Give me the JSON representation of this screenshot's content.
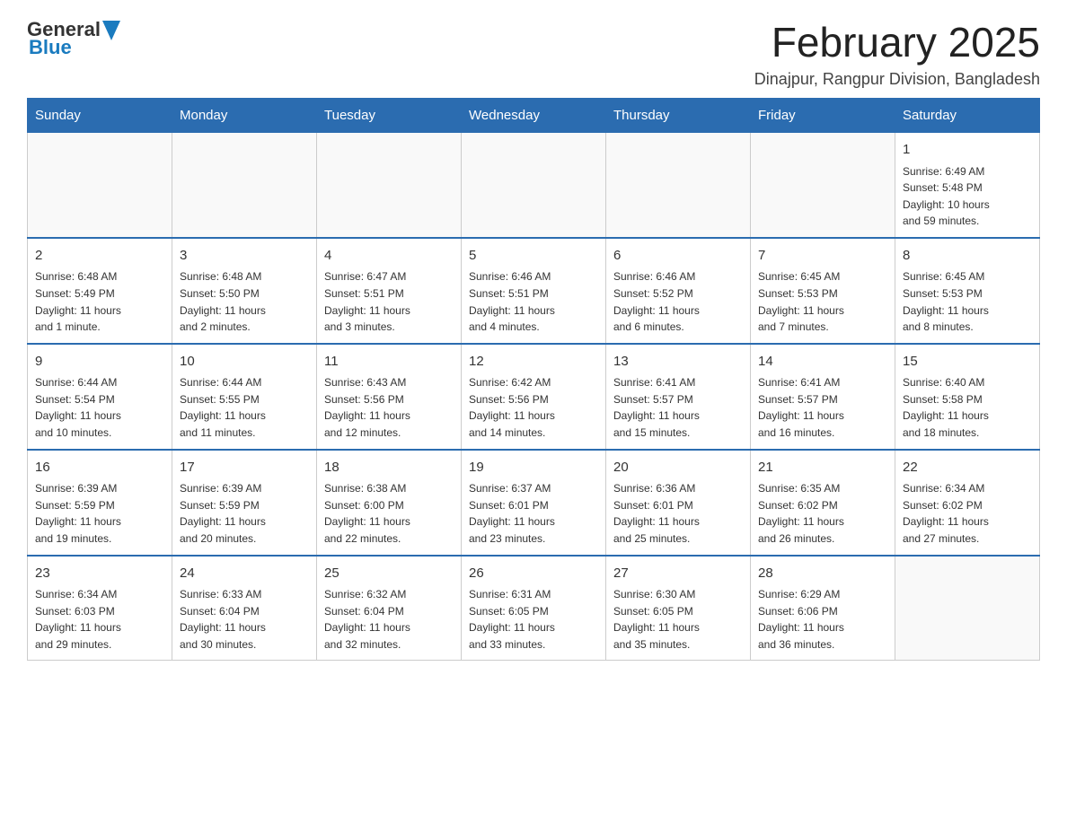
{
  "logo": {
    "text_general": "General",
    "text_blue": "Blue"
  },
  "header": {
    "month_title": "February 2025",
    "location": "Dinajpur, Rangpur Division, Bangladesh"
  },
  "weekdays": [
    "Sunday",
    "Monday",
    "Tuesday",
    "Wednesday",
    "Thursday",
    "Friday",
    "Saturday"
  ],
  "weeks": [
    [
      {
        "day": "",
        "info": ""
      },
      {
        "day": "",
        "info": ""
      },
      {
        "day": "",
        "info": ""
      },
      {
        "day": "",
        "info": ""
      },
      {
        "day": "",
        "info": ""
      },
      {
        "day": "",
        "info": ""
      },
      {
        "day": "1",
        "info": "Sunrise: 6:49 AM\nSunset: 5:48 PM\nDaylight: 10 hours\nand 59 minutes."
      }
    ],
    [
      {
        "day": "2",
        "info": "Sunrise: 6:48 AM\nSunset: 5:49 PM\nDaylight: 11 hours\nand 1 minute."
      },
      {
        "day": "3",
        "info": "Sunrise: 6:48 AM\nSunset: 5:50 PM\nDaylight: 11 hours\nand 2 minutes."
      },
      {
        "day": "4",
        "info": "Sunrise: 6:47 AM\nSunset: 5:51 PM\nDaylight: 11 hours\nand 3 minutes."
      },
      {
        "day": "5",
        "info": "Sunrise: 6:46 AM\nSunset: 5:51 PM\nDaylight: 11 hours\nand 4 minutes."
      },
      {
        "day": "6",
        "info": "Sunrise: 6:46 AM\nSunset: 5:52 PM\nDaylight: 11 hours\nand 6 minutes."
      },
      {
        "day": "7",
        "info": "Sunrise: 6:45 AM\nSunset: 5:53 PM\nDaylight: 11 hours\nand 7 minutes."
      },
      {
        "day": "8",
        "info": "Sunrise: 6:45 AM\nSunset: 5:53 PM\nDaylight: 11 hours\nand 8 minutes."
      }
    ],
    [
      {
        "day": "9",
        "info": "Sunrise: 6:44 AM\nSunset: 5:54 PM\nDaylight: 11 hours\nand 10 minutes."
      },
      {
        "day": "10",
        "info": "Sunrise: 6:44 AM\nSunset: 5:55 PM\nDaylight: 11 hours\nand 11 minutes."
      },
      {
        "day": "11",
        "info": "Sunrise: 6:43 AM\nSunset: 5:56 PM\nDaylight: 11 hours\nand 12 minutes."
      },
      {
        "day": "12",
        "info": "Sunrise: 6:42 AM\nSunset: 5:56 PM\nDaylight: 11 hours\nand 14 minutes."
      },
      {
        "day": "13",
        "info": "Sunrise: 6:41 AM\nSunset: 5:57 PM\nDaylight: 11 hours\nand 15 minutes."
      },
      {
        "day": "14",
        "info": "Sunrise: 6:41 AM\nSunset: 5:57 PM\nDaylight: 11 hours\nand 16 minutes."
      },
      {
        "day": "15",
        "info": "Sunrise: 6:40 AM\nSunset: 5:58 PM\nDaylight: 11 hours\nand 18 minutes."
      }
    ],
    [
      {
        "day": "16",
        "info": "Sunrise: 6:39 AM\nSunset: 5:59 PM\nDaylight: 11 hours\nand 19 minutes."
      },
      {
        "day": "17",
        "info": "Sunrise: 6:39 AM\nSunset: 5:59 PM\nDaylight: 11 hours\nand 20 minutes."
      },
      {
        "day": "18",
        "info": "Sunrise: 6:38 AM\nSunset: 6:00 PM\nDaylight: 11 hours\nand 22 minutes."
      },
      {
        "day": "19",
        "info": "Sunrise: 6:37 AM\nSunset: 6:01 PM\nDaylight: 11 hours\nand 23 minutes."
      },
      {
        "day": "20",
        "info": "Sunrise: 6:36 AM\nSunset: 6:01 PM\nDaylight: 11 hours\nand 25 minutes."
      },
      {
        "day": "21",
        "info": "Sunrise: 6:35 AM\nSunset: 6:02 PM\nDaylight: 11 hours\nand 26 minutes."
      },
      {
        "day": "22",
        "info": "Sunrise: 6:34 AM\nSunset: 6:02 PM\nDaylight: 11 hours\nand 27 minutes."
      }
    ],
    [
      {
        "day": "23",
        "info": "Sunrise: 6:34 AM\nSunset: 6:03 PM\nDaylight: 11 hours\nand 29 minutes."
      },
      {
        "day": "24",
        "info": "Sunrise: 6:33 AM\nSunset: 6:04 PM\nDaylight: 11 hours\nand 30 minutes."
      },
      {
        "day": "25",
        "info": "Sunrise: 6:32 AM\nSunset: 6:04 PM\nDaylight: 11 hours\nand 32 minutes."
      },
      {
        "day": "26",
        "info": "Sunrise: 6:31 AM\nSunset: 6:05 PM\nDaylight: 11 hours\nand 33 minutes."
      },
      {
        "day": "27",
        "info": "Sunrise: 6:30 AM\nSunset: 6:05 PM\nDaylight: 11 hours\nand 35 minutes."
      },
      {
        "day": "28",
        "info": "Sunrise: 6:29 AM\nSunset: 6:06 PM\nDaylight: 11 hours\nand 36 minutes."
      },
      {
        "day": "",
        "info": ""
      }
    ]
  ]
}
